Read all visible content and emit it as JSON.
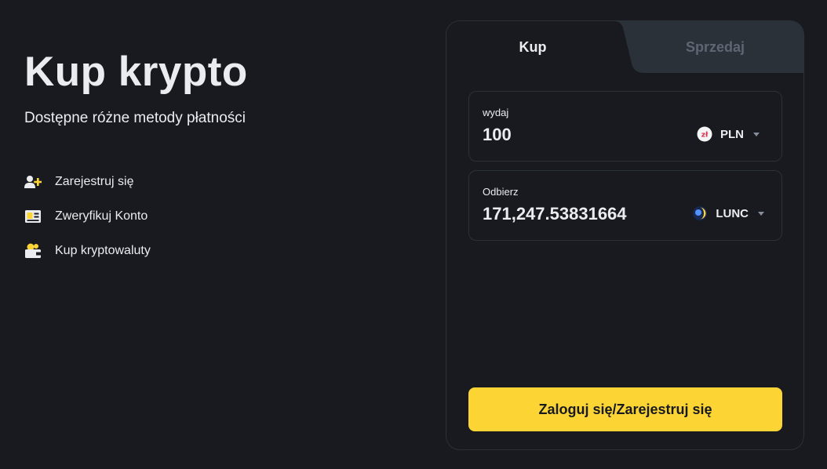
{
  "hero": {
    "title": "Kup krypto",
    "subtitle": "Dostępne różne metody płatności"
  },
  "steps": [
    {
      "icon": "add-user-icon",
      "label": "Zarejestruj się"
    },
    {
      "icon": "id-card-icon",
      "label": "Zweryfikuj Konto"
    },
    {
      "icon": "wallet-icon",
      "label": "Kup kryptowaluty"
    }
  ],
  "tabs": {
    "buy": "Kup",
    "sell": "Sprzedaj",
    "active": "buy"
  },
  "spend": {
    "label": "wydaj",
    "value": "100",
    "currency": "PLN",
    "currency_icon": "zloty-icon",
    "currency_icon_text": "zł"
  },
  "receive": {
    "label": "Odbierz",
    "value": "171,247.53831664",
    "currency": "LUNC",
    "currency_icon": "luna-classic-icon"
  },
  "cta": {
    "label": "Zaloguj się/Zarejestruj się"
  },
  "colors": {
    "background": "#181a20",
    "panel": "#2b3139",
    "accent": "#fcd535",
    "text": "#eaecef",
    "muted": "#5e6673"
  }
}
